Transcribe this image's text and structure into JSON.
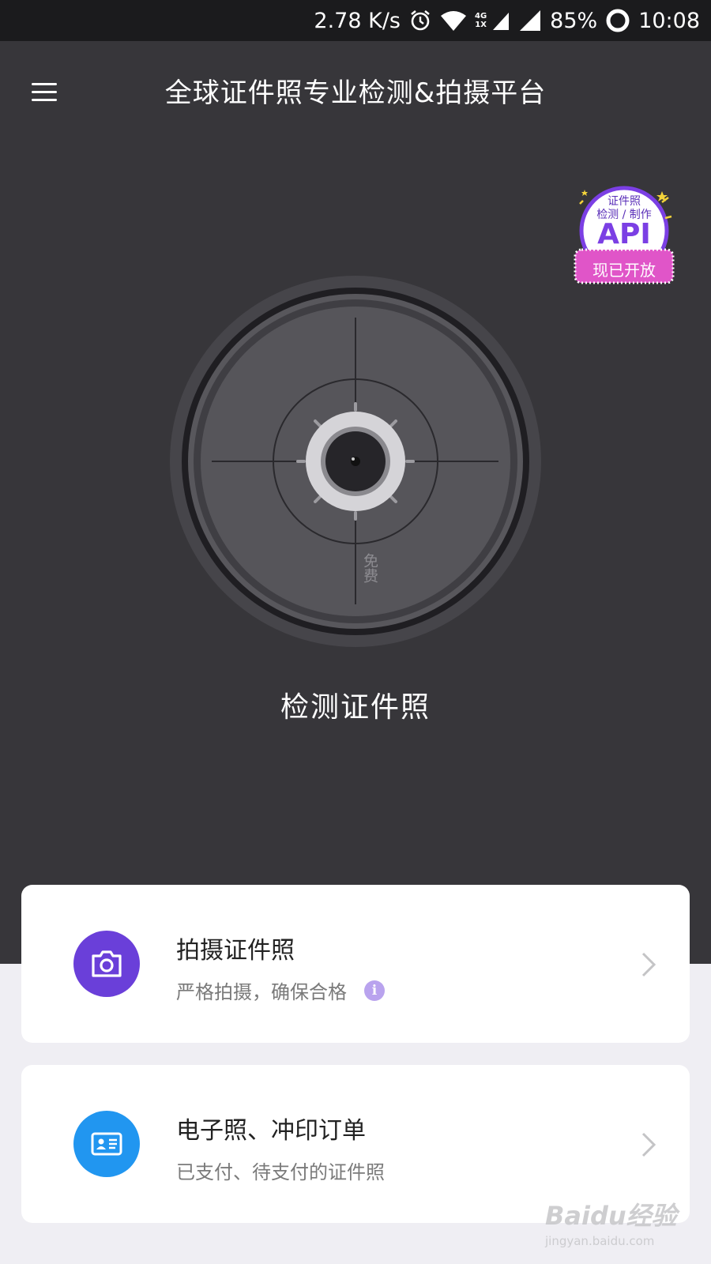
{
  "status_bar": {
    "net_speed": "2.78 K/s",
    "net_type_top": "4G",
    "net_type_bottom": "1X",
    "battery": "85%",
    "time": "10:08",
    "icons": [
      "alarm-icon",
      "wifi-icon",
      "cell-signal-icon",
      "battery-icon"
    ]
  },
  "header": {
    "menu_icon": "menu-icon",
    "title": "全球证件照专业检测&拍摄平台"
  },
  "api_badge": {
    "line1": "证件照",
    "line2": "检测 / 制作",
    "big": "API",
    "ribbon": "现已开放",
    "accent": "#7b3fe4",
    "ribbon_color": "#e055c8"
  },
  "dial": {
    "free_text": "免费",
    "label": "检测证件照"
  },
  "cards": [
    {
      "title": "拍摄证件照",
      "subtitle": "严格拍摄，确保合格",
      "icon": "camera-icon",
      "icon_color": "#6a3fd9",
      "info_icon": "i"
    },
    {
      "title": "电子照、冲印订单",
      "subtitle": "已支付、待支付的证件照",
      "icon": "id-card-icon",
      "icon_color": "#2196f0"
    }
  ],
  "watermark": {
    "main": "Baidu经验",
    "sub": "jingyan.baidu.com"
  },
  "colors": {
    "dark_bg": "#37363a",
    "status_bg": "#1b1b1d",
    "page_bg": "#efeef3"
  }
}
